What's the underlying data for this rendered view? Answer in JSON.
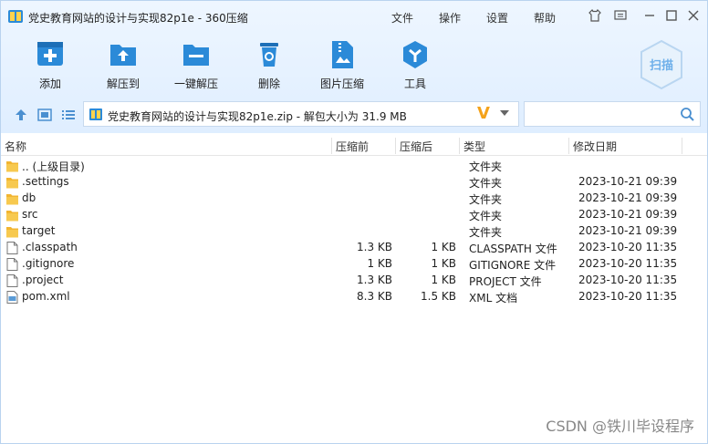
{
  "window": {
    "title": "党史教育网站的设计与实现82p1e - 360压缩",
    "menu": [
      "文件",
      "操作",
      "设置",
      "帮助"
    ]
  },
  "toolbar": {
    "buttons": [
      {
        "label": "添加",
        "icon": "add-icon"
      },
      {
        "label": "解压到",
        "icon": "extract-to-icon"
      },
      {
        "label": "一键解压",
        "icon": "one-click-extract-icon"
      },
      {
        "label": "删除",
        "icon": "delete-icon"
      },
      {
        "label": "图片压缩",
        "icon": "image-compress-icon"
      },
      {
        "label": "工具",
        "icon": "tools-icon"
      }
    ],
    "scan_label": "扫描"
  },
  "pathbar": {
    "path": "党史教育网站的设计与实现82p1e.zip - 解包大小为 31.9 MB",
    "search_placeholder": ""
  },
  "columns": {
    "name": "名称",
    "packed": "压缩前",
    "unpacked": "压缩后",
    "type": "类型",
    "modified": "修改日期"
  },
  "files": [
    {
      "name": ".. (上级目录)",
      "kind": "folder",
      "before": "",
      "after": "",
      "type": "文件夹",
      "date": ""
    },
    {
      "name": ".settings",
      "kind": "folder",
      "before": "",
      "after": "",
      "type": "文件夹",
      "date": "2023-10-21 09:39"
    },
    {
      "name": "db",
      "kind": "folder",
      "before": "",
      "after": "",
      "type": "文件夹",
      "date": "2023-10-21 09:39"
    },
    {
      "name": "src",
      "kind": "folder",
      "before": "",
      "after": "",
      "type": "文件夹",
      "date": "2023-10-21 09:39"
    },
    {
      "name": "target",
      "kind": "folder",
      "before": "",
      "after": "",
      "type": "文件夹",
      "date": "2023-10-21 09:39"
    },
    {
      "name": ".classpath",
      "kind": "file",
      "before": "1.3 KB",
      "after": "1 KB",
      "type": "CLASSPATH 文件",
      "date": "2023-10-20 11:35"
    },
    {
      "name": ".gitignore",
      "kind": "file",
      "before": "1 KB",
      "after": "1 KB",
      "type": "GITIGNORE 文件",
      "date": "2023-10-20 11:35"
    },
    {
      "name": ".project",
      "kind": "file",
      "before": "1.3 KB",
      "after": "1 KB",
      "type": "PROJECT 文件",
      "date": "2023-10-20 11:35"
    },
    {
      "name": "pom.xml",
      "kind": "xml",
      "before": "8.3 KB",
      "after": "1.5 KB",
      "type": "XML 文档",
      "date": "2023-10-20 11:35"
    }
  ],
  "watermark": "CSDN @铁川毕设程序",
  "colors": {
    "accent": "#2b8ad8",
    "folder": "#f2b531"
  }
}
